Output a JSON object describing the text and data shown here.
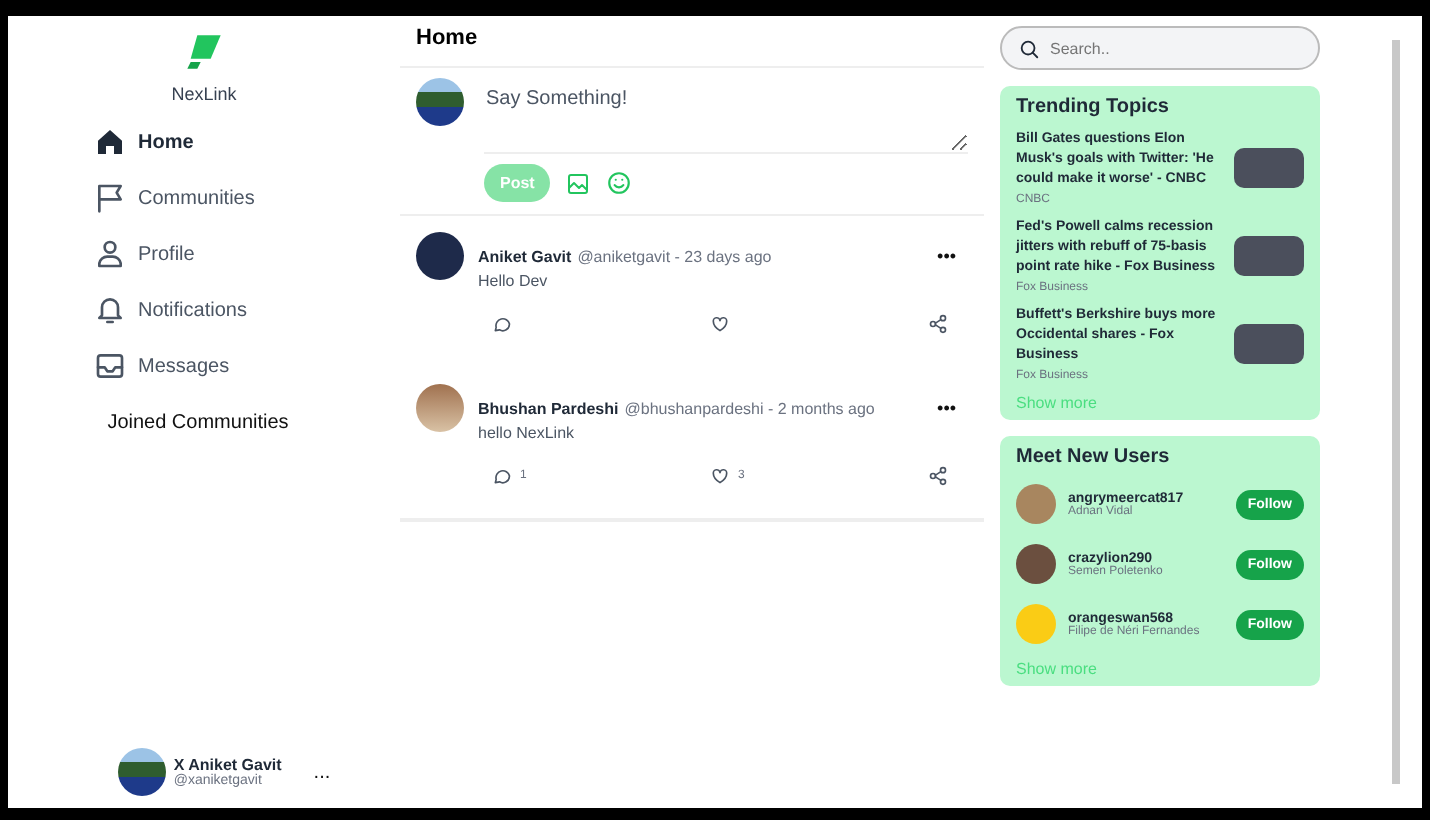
{
  "brand": {
    "name": "NexLink"
  },
  "nav": [
    {
      "label": "Home",
      "selected": true
    },
    {
      "label": "Communities",
      "selected": false
    },
    {
      "label": "Profile",
      "selected": false
    },
    {
      "label": "Notifications",
      "selected": false
    },
    {
      "label": "Messages",
      "selected": false
    }
  ],
  "joined_communities": {
    "title": "Joined Communities"
  },
  "current_user": {
    "name": "X Aniket Gavit",
    "handle": "@xaniketgavit",
    "more": "..."
  },
  "main": {
    "title": "Home"
  },
  "composer": {
    "placeholder": "Say Something!",
    "post_button": {
      "label": "Post",
      "disabled": true
    }
  },
  "posts": [
    {
      "name": "Aniket Gavit",
      "meta": "@aniketgavit - 23 days ago",
      "text": "Hello Dev",
      "more": "•••"
    },
    {
      "name": "Bhushan Pardeshi",
      "meta": "@bhushanpardeshi - 2 months ago",
      "text": "hello NexLink",
      "more": "•••",
      "comments": "1",
      "likes": "3"
    }
  ],
  "search": {
    "placeholder": "Search.."
  },
  "trending": {
    "title": "Trending Topics",
    "items": [
      {
        "headline": "Bill Gates questions Elon Musk's goals with Twitter: 'He could make it worse' - CNBC",
        "source": "CNBC"
      },
      {
        "headline": "Fed's Powell calms recession jitters with rebuff of 75-basis point rate hike - Fox Business",
        "source": "Fox Business"
      },
      {
        "headline": "Buffett's Berkshire buys more Occidental shares - Fox Business",
        "source": "Fox Business"
      }
    ],
    "show_more": "Show more"
  },
  "new_users": {
    "title": "Meet New Users",
    "items": [
      {
        "username": "angrymeercat817",
        "name": "Adnan Vidal",
        "button": "Follow"
      },
      {
        "username": "crazylion290",
        "name": "Semen Poletenko",
        "button": "Follow"
      },
      {
        "username": "orangeswan568",
        "name": "Filipe de Néri Fernandes",
        "button": "Follow"
      }
    ],
    "show_more": "Show more"
  }
}
